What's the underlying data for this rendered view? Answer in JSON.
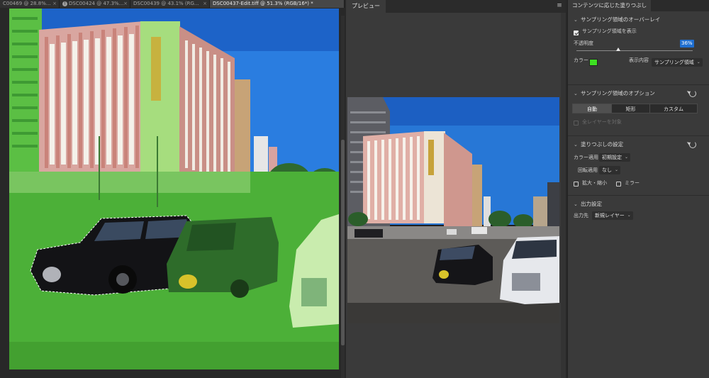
{
  "tabs": [
    {
      "label": "C00469 @ 28.8%...",
      "close": "×",
      "active": false,
      "warning": false
    },
    {
      "label": "DSC00424 @ 47.3%...",
      "close": "×",
      "active": false,
      "warning": true
    },
    {
      "label": "DSC00439 @ 43.1% (RG...",
      "close": "×",
      "active": false,
      "warning": false
    },
    {
      "label": "DSC00437-Edit.tiff @ 51.3% (RGB/16*) *",
      "close": "",
      "active": true,
      "warning": false
    }
  ],
  "preview": {
    "tab_label": "プレビュー",
    "menu_icon": "≡"
  },
  "panel": {
    "title": "コンテンツに応じた塗りつぶし",
    "overlay_section": {
      "title": "サンプリング領域のオーバーレイ",
      "show_label": "サンプリング領域を表示",
      "show_checked": true,
      "opacity_label": "不透明度",
      "opacity_value": "36%",
      "opacity_fraction": 0.36,
      "color_label": "カラー",
      "color": "#3de022",
      "display_label": "表示内容",
      "display_value": "サンプリング領域"
    },
    "options_section": {
      "title": "サンプリング領域のオプション",
      "modes": [
        "自動",
        "矩形",
        "カスタム"
      ],
      "selected_mode": "自動",
      "all_layers_label": "全レイヤーを対象",
      "all_layers_checked": false
    },
    "fill_section": {
      "title": "塗りつぶしの設定",
      "color_adapt_label": "カラー適用",
      "color_adapt_value": "初期設定",
      "rotation_label": "回転適用",
      "rotation_value": "なし",
      "scale_label": "拡大・縮小",
      "scale_checked": false,
      "mirror_label": "ミラー",
      "mirror_checked": false
    },
    "output_section": {
      "title": "出力設定",
      "output_label": "出力先",
      "output_value": "新規レイヤー"
    }
  },
  "colors": {
    "overlay_green": "#3de022",
    "accent_blue": "#1f6fd1"
  },
  "icons": {
    "chevron": "chevron-down-icon",
    "reset": "reset-icon",
    "menu": "panel-menu-icon",
    "close": "close-icon",
    "warning": "warning-icon"
  }
}
